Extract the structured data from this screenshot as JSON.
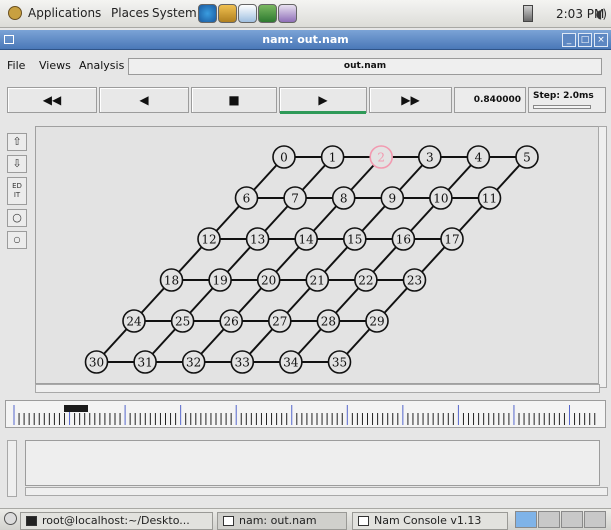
{
  "panel": {
    "menus": [
      "Applications",
      "Places",
      "System"
    ],
    "clock": "2:03 PM"
  },
  "window": {
    "title": "nam: out.nam"
  },
  "menubar": {
    "items": [
      "File",
      "Views",
      "Analysis"
    ],
    "filename": "out.nam"
  },
  "controls": {
    "buttons": [
      "◀◀",
      "◀",
      "■",
      "▶",
      "▶▶"
    ],
    "time": "0.840000",
    "step_label": "Step: 2.0ms"
  },
  "left_toolbar": {
    "edit_label": "ED IT"
  },
  "timeline": {
    "marker_label": ""
  },
  "taskbar": {
    "tasks": [
      "root@localhost:~/Deskto...",
      "nam: out.nam",
      "Nam Console v1.13"
    ]
  },
  "network": {
    "highlight_color": "#f29ab0",
    "node_labels": [
      "0",
      "1",
      "2",
      "3",
      "4",
      "5",
      "6",
      "7",
      "8",
      "9",
      "10",
      "11",
      "12",
      "13",
      "14",
      "15",
      "16",
      "17",
      "18",
      "19",
      "20",
      "21",
      "22",
      "23",
      "24",
      "25",
      "26",
      "27",
      "28",
      "29",
      "30",
      "31",
      "32",
      "33",
      "34",
      "35"
    ],
    "highlighted_node": "2"
  },
  "colors": {
    "titlebar": "#4a78b8",
    "play_indicator": "#2e9a58",
    "timeline_ticks": "#5566cc"
  }
}
